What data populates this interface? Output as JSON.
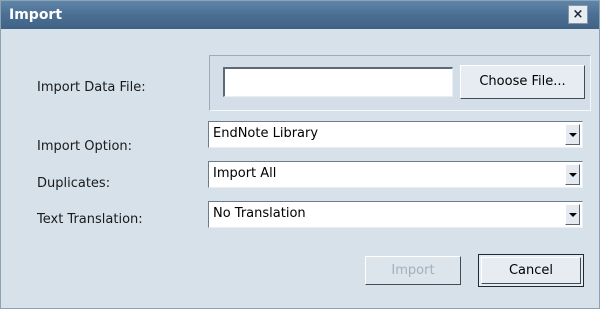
{
  "window": {
    "title": "Import",
    "close_label": "×"
  },
  "form": {
    "import_data_file": {
      "label": "Import Data File:",
      "value": "",
      "choose_button": "Choose File..."
    },
    "import_option": {
      "label": "Import Option:",
      "selected": "EndNote Library"
    },
    "duplicates": {
      "label": "Duplicates:",
      "selected": "Import All"
    },
    "text_translation": {
      "label": "Text Translation:",
      "selected": "No Translation"
    }
  },
  "buttons": {
    "import": {
      "label": "Import",
      "enabled": false
    },
    "cancel": {
      "label": "Cancel",
      "enabled": true
    }
  },
  "icons": {
    "close": "close-icon",
    "dropdown": "chevron-down-icon"
  }
}
